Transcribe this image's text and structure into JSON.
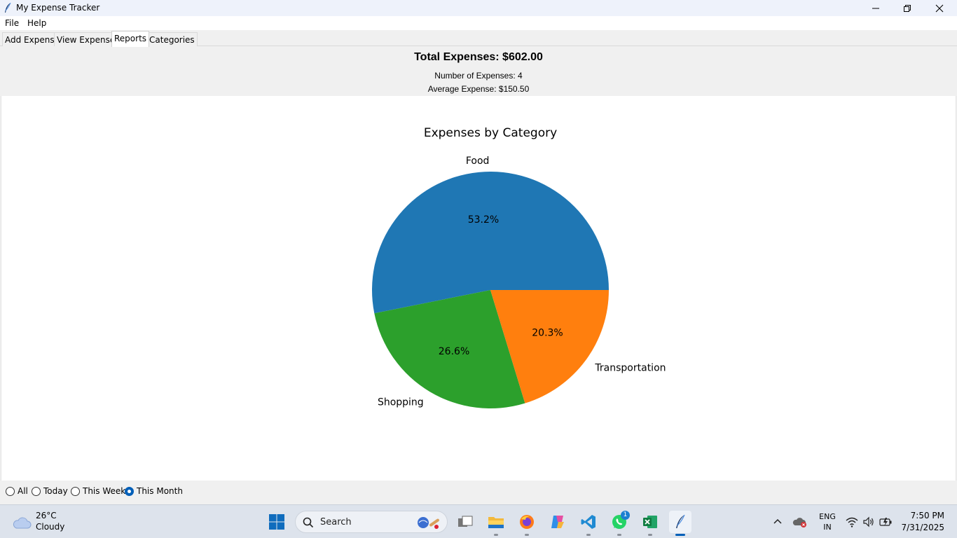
{
  "window": {
    "title": "My Expense Tracker"
  },
  "menu": {
    "items": [
      "File",
      "Help"
    ]
  },
  "tabs": [
    "Add Expense",
    "View Expenses",
    "Reports",
    "Categories"
  ],
  "active_tab": "Reports",
  "summary": {
    "total": "Total Expenses: $602.00",
    "count": "Number of Expenses: 4",
    "average": "Average Expense: $150.50"
  },
  "chart_data": {
    "type": "pie",
    "title": "Expenses by Category",
    "slices": [
      {
        "label": "Food",
        "percent": 53.2,
        "display": "53.2%",
        "color": "#1f77b4"
      },
      {
        "label": "Shopping",
        "percent": 26.6,
        "display": "26.6%",
        "color": "#2ca02c"
      },
      {
        "label": "Transportation",
        "percent": 20.3,
        "display": "20.3%",
        "color": "#ff7f0e"
      }
    ]
  },
  "filter": {
    "options": [
      "All",
      "Today",
      "This Week",
      "This Month"
    ],
    "selected": "This Month"
  },
  "taskbar": {
    "weather": {
      "temp": "26°C",
      "condition": "Cloudy"
    },
    "search_label": "Search",
    "whatsapp_badge": "1",
    "language": {
      "line1": "ENG",
      "line2": "IN"
    },
    "time": "7:50 PM",
    "date": "7/31/2025"
  }
}
